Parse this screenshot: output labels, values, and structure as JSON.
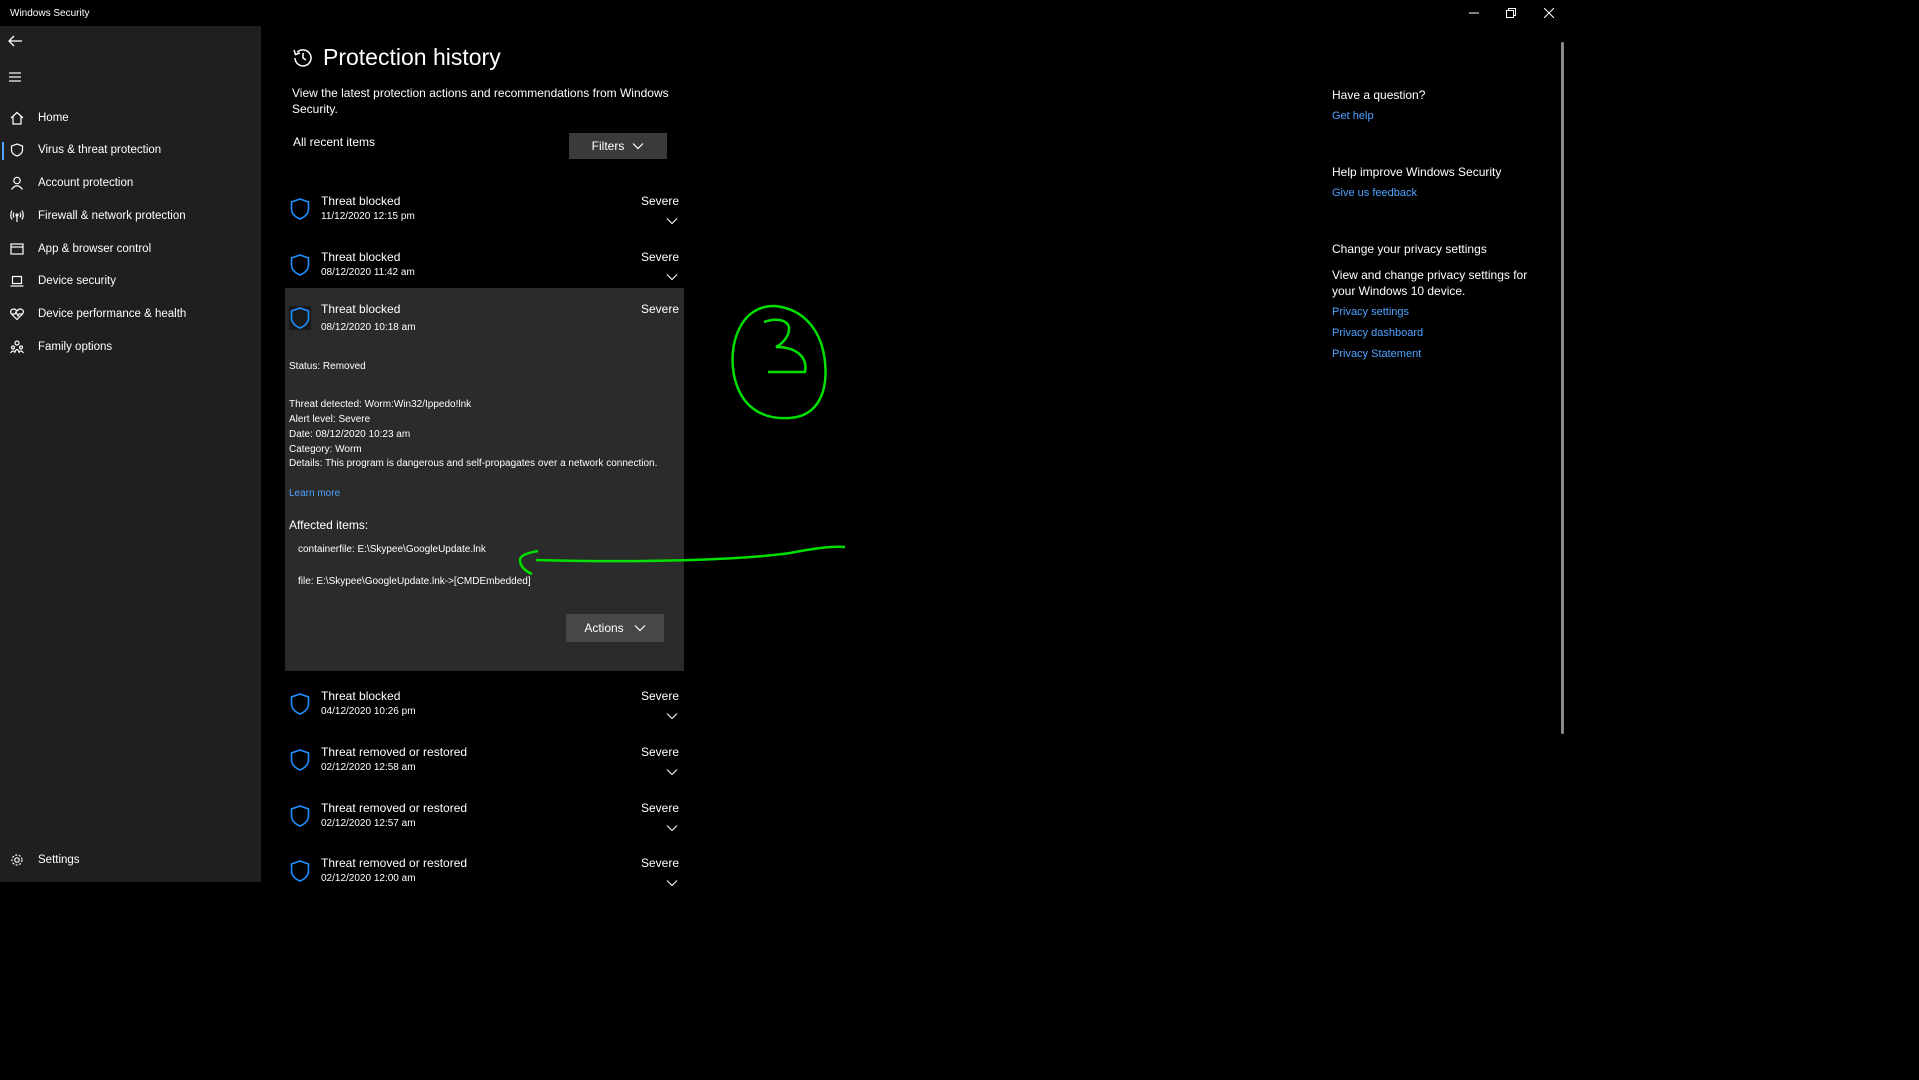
{
  "window": {
    "title": "Windows Security",
    "controls": [
      "minimize-icon",
      "restore-icon",
      "close-icon"
    ]
  },
  "sidebar": {
    "items": [
      {
        "label": "Home",
        "icon": "home-icon"
      },
      {
        "label": "Virus & threat protection",
        "icon": "shield-icon",
        "active": true
      },
      {
        "label": "Account protection",
        "icon": "person-icon"
      },
      {
        "label": "Firewall & network protection",
        "icon": "wireless-icon"
      },
      {
        "label": "App & browser control",
        "icon": "app-window-icon"
      },
      {
        "label": "Device security",
        "icon": "laptop-icon"
      },
      {
        "label": "Device performance & health",
        "icon": "heart-icon"
      },
      {
        "label": "Family options",
        "icon": "family-icon"
      }
    ],
    "settings_label": "Settings"
  },
  "main": {
    "title": "Protection history",
    "description": "View the latest protection actions and recommendations from Windows Security.",
    "recent_label": "All recent items",
    "filters_label": "Filters",
    "items": [
      {
        "title": "Threat blocked",
        "date": "11/12/2020 12:15 pm",
        "severity": "Severe"
      },
      {
        "title": "Threat blocked",
        "date": "08/12/2020 11:42 am",
        "severity": "Severe"
      },
      {
        "title": "Threat blocked",
        "date": "04/12/2020 10:26 pm",
        "severity": "Severe"
      },
      {
        "title": "Threat removed or restored",
        "date": "02/12/2020 12:58 am",
        "severity": "Severe"
      },
      {
        "title": "Threat removed or restored",
        "date": "02/12/2020 12:57 am",
        "severity": "Severe"
      },
      {
        "title": "Threat removed or restored",
        "date": "02/12/2020 12:00 am",
        "severity": "Severe"
      }
    ],
    "expanded": {
      "title": "Threat blocked",
      "date": "08/12/2020 10:18 am",
      "severity": "Severe",
      "status": "Status: Removed",
      "threat_detected": "Threat detected:  Worm:Win32/Ippedo!lnk",
      "alert_level": "Alert level: Severe",
      "date_line": "Date:  08/12/2020 10:23 am",
      "category": "Category:  Worm",
      "details": "Details:  This program is dangerous and self-propagates over a network connection.",
      "learn_more": "Learn more",
      "affected_heading": "Affected items:",
      "affected_items": [
        "containerfile: E:\\Skypee\\GoogleUpdate.lnk",
        "file: E:\\Skypee\\GoogleUpdate.lnk->[CMDEmbedded]"
      ],
      "actions_label": "Actions"
    }
  },
  "right_panel": {
    "question_heading": "Have a question?",
    "get_help": "Get help",
    "improve_heading": "Help improve Windows Security",
    "feedback": "Give us feedback",
    "privacy_heading": "Change your privacy settings",
    "privacy_text": "View and change privacy settings for your Windows 10 device.",
    "links": [
      "Privacy settings",
      "Privacy dashboard",
      "Privacy Statement"
    ]
  },
  "colors": {
    "sidebar_bg": "#1f1f1f",
    "content_bg": "#000000",
    "expanded_bg": "#2b2b2b",
    "link": "#4ea3ff",
    "shield_accent": "#1e8fff",
    "annotation": "#00e000"
  }
}
